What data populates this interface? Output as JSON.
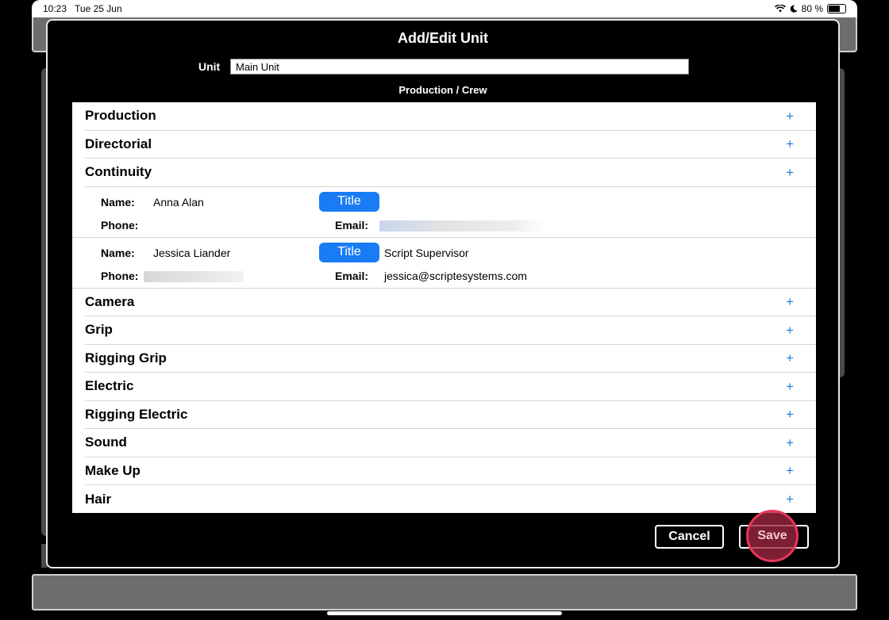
{
  "status_bar": {
    "time": "10:23",
    "date": "Tue 25 Jun",
    "battery_percent": "80 %",
    "battery_level": 0.8
  },
  "modal": {
    "title": "Add/Edit Unit",
    "unit_label": "Unit",
    "unit_value": "Main Unit",
    "section_heading": "Production / Crew"
  },
  "departments_before": [
    {
      "label": "Production"
    },
    {
      "label": "Directorial"
    },
    {
      "label": "Continuity"
    }
  ],
  "continuity_members": [
    {
      "name_label": "Name:",
      "name": "Anna Alan",
      "title_button": "Title",
      "title": "",
      "phone_label": "Phone:",
      "phone": "",
      "email_label": "Email:",
      "email": ""
    },
    {
      "name_label": "Name:",
      "name": "Jessica Liander",
      "title_button": "Title",
      "title": "Script Supervisor",
      "phone_label": "Phone:",
      "phone": "",
      "email_label": "Email:",
      "email": "jessica@scriptesystems.com"
    }
  ],
  "departments_after": [
    {
      "label": "Camera"
    },
    {
      "label": "Grip"
    },
    {
      "label": "Rigging Grip"
    },
    {
      "label": "Electric"
    },
    {
      "label": "Rigging Electric"
    },
    {
      "label": "Sound"
    },
    {
      "label": "Make Up"
    },
    {
      "label": "Hair"
    }
  ],
  "add_glyph": "+",
  "buttons": {
    "cancel": "Cancel",
    "save": "Save"
  },
  "colors": {
    "accent_blue": "#1a7cf5",
    "plus_blue": "#1f7ad8",
    "tap_indicator": "#e5385a"
  }
}
